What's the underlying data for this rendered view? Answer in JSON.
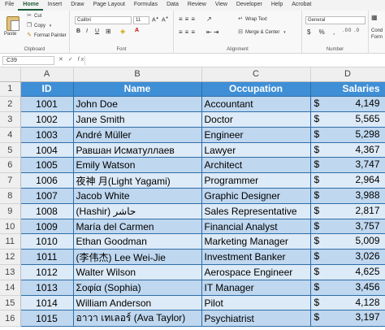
{
  "menu": [
    "File",
    "Home",
    "Insert",
    "Draw",
    "Page Layout",
    "Formulas",
    "Data",
    "Review",
    "View",
    "Developer",
    "Help",
    "Acrobat"
  ],
  "menu_active": "Home",
  "ribbon": {
    "clipboard": {
      "paste": "Paste",
      "cut": "Cut",
      "copy": "Copy",
      "format_painter": "Format Painter",
      "label": "Clipboard"
    },
    "font": {
      "font_name": "Calibri",
      "font_size": "11",
      "bold": "B",
      "italic": "I",
      "underline": "U",
      "label": "Font"
    },
    "alignment": {
      "wrap_text": "Wrap Text",
      "merge_center": "Merge & Center",
      "label": "Alignment"
    },
    "number": {
      "format": "General",
      "label": "Number"
    },
    "styles": {
      "conditional": "Cond",
      "formatting": "Form"
    }
  },
  "formula_bar": {
    "name_box": "C39",
    "fx": "fx",
    "value": ""
  },
  "columns": [
    "A",
    "B",
    "C",
    "D"
  ],
  "header": {
    "row_num": "1",
    "id": "ID",
    "name": "Name",
    "occupation": "Occupation",
    "salaries": "Salaries"
  },
  "rows": [
    {
      "row": "2",
      "id": "1001",
      "name": "John Doe",
      "occupation": "Accountant",
      "currency": "$",
      "salary": "4,149"
    },
    {
      "row": "3",
      "id": "1002",
      "name": "Jane Smith",
      "occupation": "Doctor",
      "currency": "$",
      "salary": "5,565"
    },
    {
      "row": "4",
      "id": "1003",
      "name": "André Müller",
      "occupation": "Engineer",
      "currency": "$",
      "salary": "5,298"
    },
    {
      "row": "5",
      "id": "1004",
      "name": "Равшан Исматуллаев",
      "occupation": "Lawyer",
      "currency": "$",
      "salary": "4,367"
    },
    {
      "row": "6",
      "id": "1005",
      "name": "Emily Watson",
      "occupation": "Architect",
      "currency": "$",
      "salary": "3,747"
    },
    {
      "row": "7",
      "id": "1006",
      "name": "夜神 月(Light Yagami)",
      "occupation": "Programmer",
      "currency": "$",
      "salary": "2,964"
    },
    {
      "row": "8",
      "id": "1007",
      "name": "Jacob White",
      "occupation": "Graphic Designer",
      "currency": "$",
      "salary": "3,988"
    },
    {
      "row": "9",
      "id": "1008",
      "name": "(Hashir) حاشر",
      "occupation": "Sales Representative",
      "currency": "$",
      "salary": "2,817"
    },
    {
      "row": "10",
      "id": "1009",
      "name": "María del Carmen",
      "occupation": "Financial Analyst",
      "currency": "$",
      "salary": "3,757"
    },
    {
      "row": "11",
      "id": "1010",
      "name": "Ethan Goodman",
      "occupation": "Marketing Manager",
      "currency": "$",
      "salary": "5,009"
    },
    {
      "row": "12",
      "id": "1011",
      "name": "(李伟杰) Lee Wei-Jie",
      "occupation": "Investment Banker",
      "currency": "$",
      "salary": "3,026"
    },
    {
      "row": "13",
      "id": "1012",
      "name": "Walter Wilson",
      "occupation": "Aerospace Engineer",
      "currency": "$",
      "salary": "4,625"
    },
    {
      "row": "14",
      "id": "1013",
      "name": "Σοφία (Sophia)",
      "occupation": "IT Manager",
      "currency": "$",
      "salary": "3,456"
    },
    {
      "row": "15",
      "id": "1014",
      "name": "William Anderson",
      "occupation": "Pilot",
      "currency": "$",
      "salary": "4,128"
    },
    {
      "row": "16",
      "id": "1015",
      "name": "อาวา เทเลอร์ (Ava Taylor)",
      "occupation": "Psychiatrist",
      "currency": "$",
      "salary": "3,197"
    }
  ]
}
